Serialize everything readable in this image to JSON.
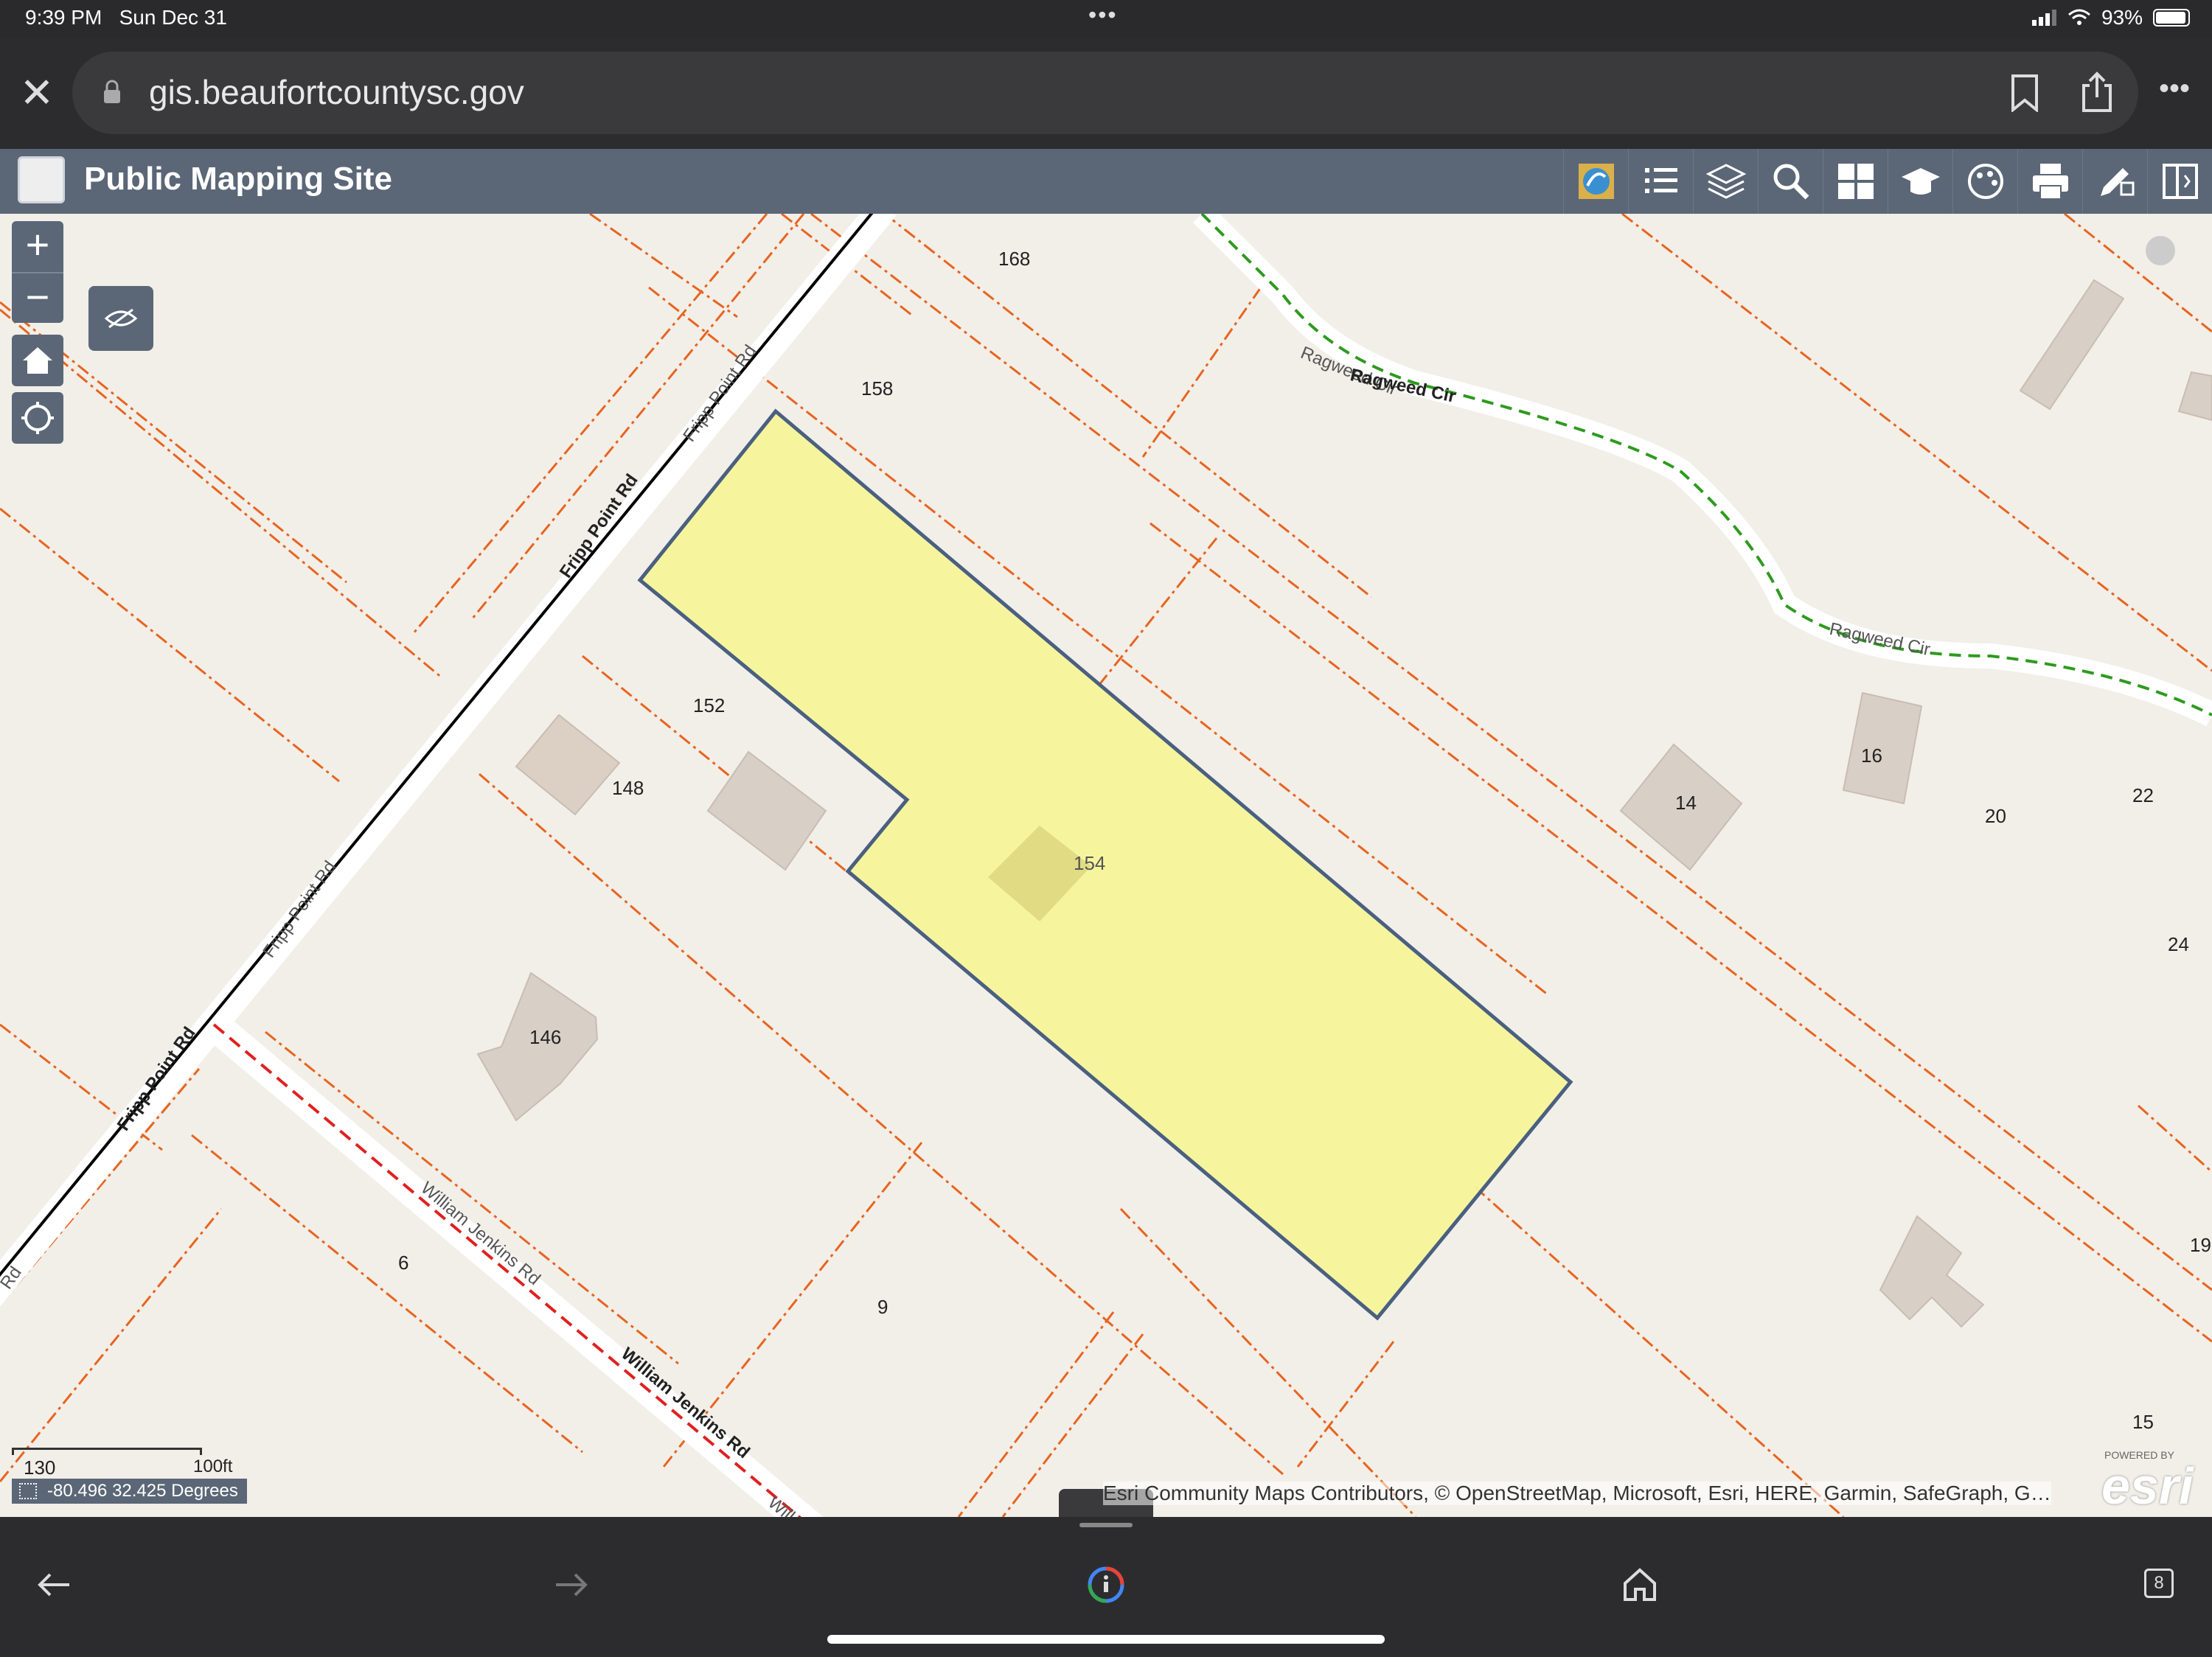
{
  "status": {
    "time": "9:39 PM",
    "date": "Sun Dec 31",
    "battery": "93%"
  },
  "browser": {
    "url": "gis.beaufortcountysc.gov"
  },
  "app": {
    "title": "Public Mapping Site",
    "tools": [
      "app-logo-icon",
      "legend-icon",
      "layers-icon",
      "search-icon",
      "basemap-gallery-icon",
      "education-icon",
      "theme-icon",
      "print-icon",
      "draw-icon",
      "side-panel-icon"
    ]
  },
  "map": {
    "parcel_labels": [
      "168",
      "158",
      "152",
      "148",
      "154",
      "146",
      "6",
      "9",
      "14",
      "16",
      "20",
      "22",
      "24",
      "19",
      "15"
    ],
    "road_labels": {
      "fripp1": "Fripp Point Rd",
      "fripp2": "Fripp Point Rd",
      "fripp3": "Fripp Point Rd",
      "fripp4": "Fripp Point Rd",
      "fripp5": "Rd",
      "ragweed1": "Ragweed Cir",
      "ragweed2": "Ragweed Cir",
      "ragweed3": "Ragweed Cir",
      "jenkins1": "William Jenkins Rd",
      "jenkins2": "William Jenkins Rd",
      "jenkins3": "Will"
    },
    "scale": {
      "left": "130",
      "right": "100ft"
    },
    "coordinates": "-80.496 32.425 Degrees",
    "attribution": "Esri Community Maps Contributors, © OpenStreetMap, Microsoft, Esri, HERE, Garmin, SafeGraph, G…",
    "esri_powered": "POWERED BY",
    "esri_name": "esri",
    "colors": {
      "parcel_line": "#e8641e",
      "selected_fill": "#f5f49a",
      "selected_outline": "#4a6080",
      "building": "#d8cfc6"
    }
  },
  "controls": {
    "zoom_in": "+",
    "zoom_out": "−"
  },
  "bottom_nav": {
    "tab_count": "8"
  }
}
